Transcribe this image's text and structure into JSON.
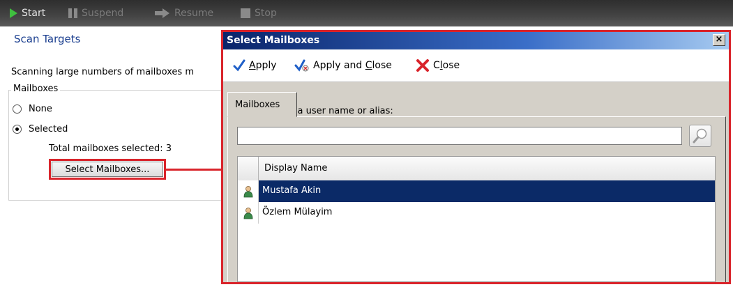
{
  "toolbar": {
    "start": "Start",
    "suspend": "Suspend",
    "resume": "Resume",
    "stop": "Stop"
  },
  "left": {
    "title": "Scan Targets",
    "description": "Scanning large numbers of mailboxes m",
    "group_label": "Mailboxes",
    "radio_none": "None",
    "radio_selected": "Selected",
    "selected_option": "Selected",
    "total_text": "Total mailboxes selected: 3",
    "select_button": "Select Mailboxes..."
  },
  "dialog": {
    "title": "Select Mailboxes",
    "close_glyph": "×",
    "apply_pre": "",
    "apply_key": "A",
    "apply_post": "pply",
    "apply_close_pre": "Apply and ",
    "apply_close_key": "C",
    "apply_close_post": "lose",
    "close_pre": "C",
    "close_key": "l",
    "close_post": "ose",
    "tab": "Mailboxes",
    "hint": "Enter part of a user name or alias:",
    "search_value": "",
    "column_header": "Display Name",
    "rows": [
      {
        "name": "Mustafa Akin",
        "selected": true
      },
      {
        "name": "Özlem Mülayim",
        "selected": false
      }
    ]
  },
  "colors": {
    "highlight_red": "#d9242b",
    "selection_blue": "#0b2a67",
    "title_blue": "#1a3e8f",
    "start_green": "#3fc03f"
  }
}
